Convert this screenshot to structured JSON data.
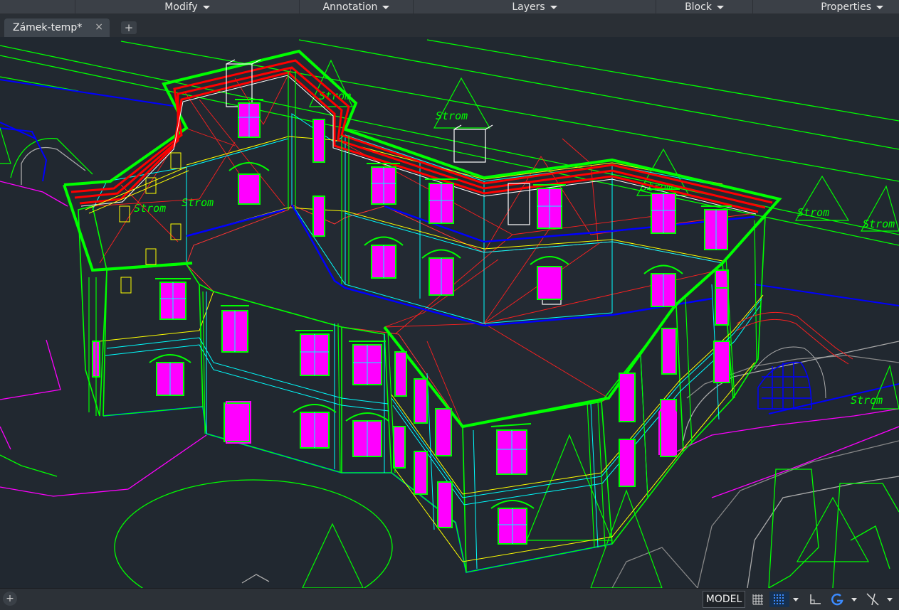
{
  "ribbon": {
    "panels": [
      {
        "label": "Modify"
      },
      {
        "label": "Annotation"
      },
      {
        "label": "Layers"
      },
      {
        "label": "Block"
      },
      {
        "label": "Properties"
      }
    ]
  },
  "tabs": {
    "active_label": "Zámek-temp*",
    "close_glyph": "×",
    "add_glyph": "+"
  },
  "drawing": {
    "tree_label": "Strom",
    "colors": {
      "walls": "#00ff00",
      "roof": "#ff0000",
      "windows": "#ff00ff",
      "trim": "#00ffff",
      "base": "#0000ff",
      "rails": "#ffff00"
    }
  },
  "status": {
    "space_label": "MODEL",
    "icons": [
      "grid-icon",
      "snap-grid-icon",
      "ortho-icon",
      "polar-icon",
      "object-snap-icon"
    ]
  }
}
